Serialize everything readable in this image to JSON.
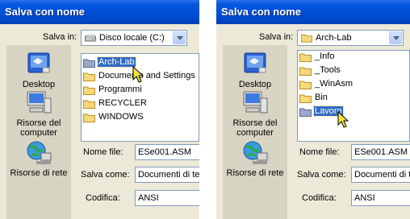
{
  "left": {
    "title": "Salva con nome",
    "save_in_label": "Salva in:",
    "save_in_value": "Disco locale (C:)",
    "places": [
      "Desktop",
      "Risorse del computer",
      "Risorse di rete"
    ],
    "files": [
      "Arch-Lab",
      "Documents and Settings",
      "Programmi",
      "RECYCLER",
      "WINDOWS"
    ],
    "selected_file": "Arch-Lab",
    "filename_label": "Nome file:",
    "filename_value": "ESe001.ASM",
    "savetype_label": "Salva come:",
    "savetype_value": "Documenti di testo",
    "encoding_label": "Codifica:",
    "encoding_value": "ANSI"
  },
  "right": {
    "title": "Salva con nome",
    "save_in_label": "Salva in:",
    "save_in_value": "Arch-Lab",
    "places": [
      "Desktop",
      "Risorse del computer",
      "Risorse di rete"
    ],
    "files": [
      "_Info",
      "_Tools",
      "_WinAsm",
      "Bin",
      "Lavoro"
    ],
    "selected_file": "Lavoro",
    "filename_label": "Nome file:",
    "filename_value": "ESe001.ASM",
    "savetype_label": "Salva come:",
    "savetype_value": "Documenti di testo",
    "encoding_label": "Codifica:",
    "encoding_value": "ANSI"
  },
  "icons": {
    "drive": "hard-drive-icon",
    "folder": "folder-icon",
    "desktop": "desktop-icon",
    "computer": "computer-icon",
    "network": "network-icon",
    "pointer": "mouse-pointer-icon"
  },
  "colors": {
    "titlebar": "#0050d8",
    "dialog_bg": "#ece9d8",
    "selection": "#316ac5",
    "folder": "#f6d87a"
  }
}
